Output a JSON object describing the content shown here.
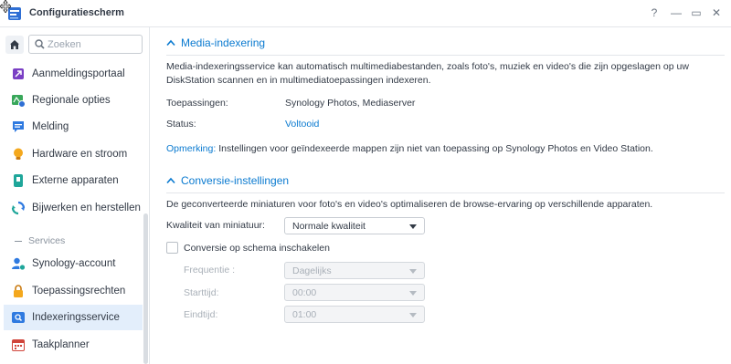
{
  "window": {
    "title": "Configuratiescherm",
    "buttons": {
      "help": "?",
      "minimize": "—",
      "maximize": "▭",
      "close": "✕"
    }
  },
  "sidebar": {
    "search_placeholder": "Zoeken",
    "items": [
      {
        "label": "Aanmeldingsportaal",
        "icon": "login-portal-icon",
        "active": false
      },
      {
        "label": "Regionale opties",
        "icon": "regional-options-icon",
        "active": false
      },
      {
        "label": "Melding",
        "icon": "notification-icon",
        "active": false
      },
      {
        "label": "Hardware en stroom",
        "icon": "hardware-power-icon",
        "active": false
      },
      {
        "label": "Externe apparaten",
        "icon": "external-devices-icon",
        "active": false
      },
      {
        "label": "Bijwerken en herstellen",
        "icon": "update-restore-icon",
        "active": false
      }
    ],
    "section_label": "Services",
    "service_items": [
      {
        "label": "Synology-account",
        "icon": "synology-account-icon",
        "active": false
      },
      {
        "label": "Toepassingsrechten",
        "icon": "application-privileges-icon",
        "active": false
      },
      {
        "label": "Indexeringsservice",
        "icon": "indexing-service-icon",
        "active": true
      },
      {
        "label": "Taakplanner",
        "icon": "task-scheduler-icon",
        "active": false
      }
    ]
  },
  "media_indexing": {
    "title": "Media-indexering",
    "description": "Media-indexeringsservice kan automatisch multimediabestanden, zoals foto's, muziek en video's die zijn opgeslagen op uw DiskStation scannen en in multimediatoepassingen indexeren.",
    "applications_label": "Toepassingen:",
    "applications_value": "Synology Photos, Mediaserver",
    "status_label": "Status:",
    "status_value": "Voltooid",
    "note_key": "Opmerking:",
    "note_text": " Instellingen voor geïndexeerde mappen zijn niet van toepassing op Synology Photos en Video Station."
  },
  "conversion": {
    "title": "Conversie-instellingen",
    "description": "De geconverteerde miniaturen voor foto's en video's optimaliseren de browse-ervaring op verschillende apparaten.",
    "quality_label": "Kwaliteit van miniatuur:",
    "quality_value": "Normale kwaliteit",
    "schedule_checkbox_label": "Conversie op schema inschakelen",
    "schedule_enabled": false,
    "frequency_label": "Frequentie :",
    "frequency_value": "Dagelijks",
    "start_label": "Starttijd:",
    "start_value": "00:00",
    "end_label": "Eindtijd:",
    "end_value": "01:00"
  },
  "colors": {
    "accent": "#0a7ad0",
    "active_item_bg": "#e3eefb",
    "text": "#323a46",
    "muted": "#a9b0b8"
  }
}
